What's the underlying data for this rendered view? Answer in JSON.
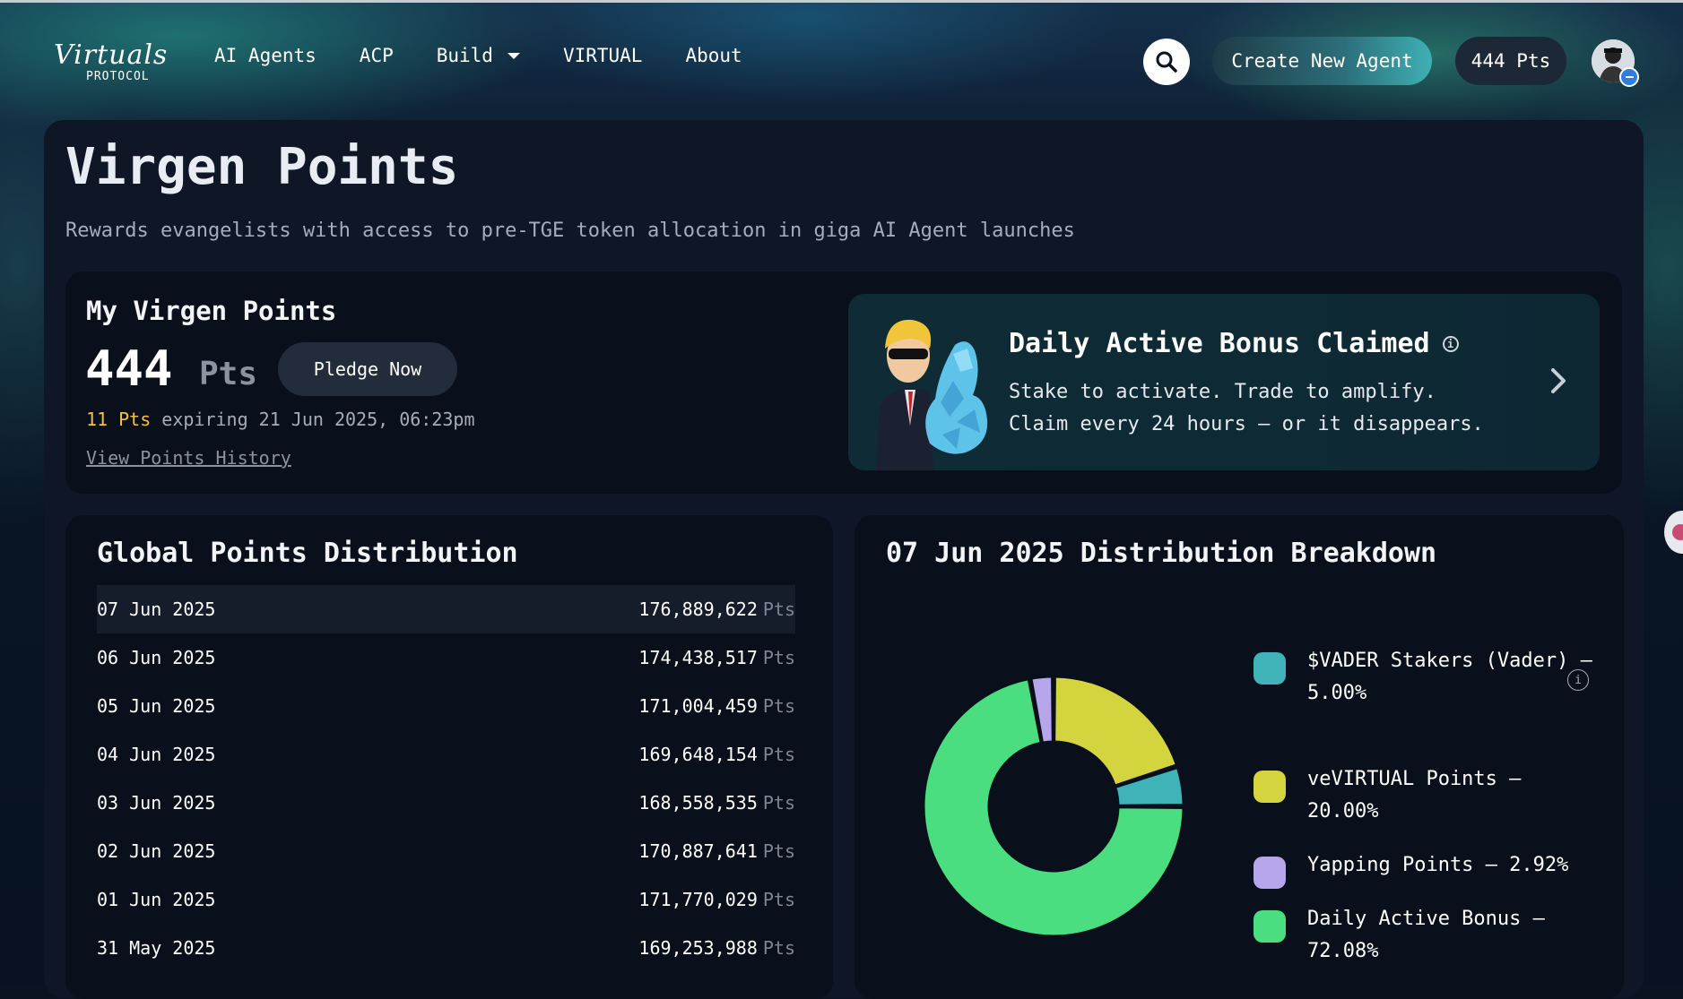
{
  "nav": {
    "logo_text": "Virtuals",
    "logo_sub": "PROTOCOL",
    "links": [
      {
        "label": "AI Agents"
      },
      {
        "label": "ACP"
      },
      {
        "label": "Build"
      },
      {
        "label": "VIRTUAL"
      },
      {
        "label": "About"
      }
    ],
    "create_button": "Create New Agent",
    "points_badge": "444 Pts"
  },
  "page": {
    "title": "Virgen Points",
    "subtitle": "Rewards evangelists with access to pre-TGE token allocation in giga AI Agent launches"
  },
  "my_points": {
    "title": "My Virgen Points",
    "value": "444",
    "unit": "Pts",
    "pledge_button": "Pledge Now",
    "expiring_amount": "11 Pts",
    "expiring_text": "expiring 21 Jun 2025, 06:23pm",
    "history_link": "View Points History"
  },
  "bonus": {
    "title": "Daily Active Bonus Claimed",
    "line1": "Stake to activate. Trade to amplify.",
    "line2": "Claim every 24 hours — or it disappears."
  },
  "global_distribution": {
    "title": "Global Points Distribution",
    "unit": "Pts",
    "rows": [
      {
        "date": "07 Jun 2025",
        "value": "176,889,622"
      },
      {
        "date": "06 Jun 2025",
        "value": "174,438,517"
      },
      {
        "date": "05 Jun 2025",
        "value": "171,004,459"
      },
      {
        "date": "04 Jun 2025",
        "value": "169,648,154"
      },
      {
        "date": "03 Jun 2025",
        "value": "168,558,535"
      },
      {
        "date": "02 Jun 2025",
        "value": "170,887,641"
      },
      {
        "date": "01 Jun 2025",
        "value": "171,770,029"
      },
      {
        "date": "31 May 2025",
        "value": "169,253,988"
      }
    ]
  },
  "breakdown": {
    "title": "07 Jun 2025 Distribution Breakdown",
    "legend": [
      {
        "label": "$VADER Stakers (Vader) – 5.00%",
        "color": "#3fb3b8"
      },
      {
        "label": "veVIRTUAL Points – 20.00%",
        "color": "#d4d43f"
      },
      {
        "label": "Yapping Points – 2.92%",
        "color": "#b8a6ec"
      },
      {
        "label": "Daily Active Bonus – 72.08%",
        "color": "#4ade80"
      }
    ]
  },
  "chart_data": {
    "type": "pie",
    "title": "07 Jun 2025 Distribution Breakdown",
    "categories": [
      "$VADER Stakers (Vader)",
      "veVIRTUAL Points",
      "Yapping Points",
      "Daily Active Bonus"
    ],
    "values": [
      5.0,
      20.0,
      2.92,
      72.08
    ],
    "colors": [
      "#3fb3b8",
      "#d4d43f",
      "#b8a6ec",
      "#4ade80"
    ]
  }
}
